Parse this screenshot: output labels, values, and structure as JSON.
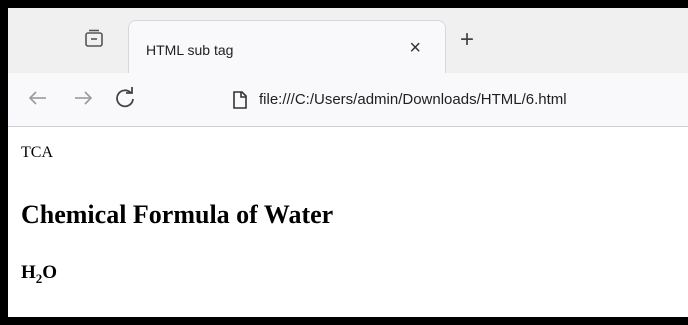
{
  "tab": {
    "title": "HTML sub tag",
    "close_glyph": "×",
    "new_tab_glyph": "+"
  },
  "toolbar": {
    "url": "file:///C:/Users/admin/Downloads/HTML/6.html",
    "icons": [
      "back-arrow-icon",
      "forward-arrow-icon",
      "reload-icon",
      "page-icon",
      "tab-overview-icon"
    ]
  },
  "content": {
    "paragraph": "TCA",
    "heading": "Chemical Formula of Water",
    "formula": {
      "base": "H",
      "subscript": "2",
      "tail": "O"
    }
  }
}
